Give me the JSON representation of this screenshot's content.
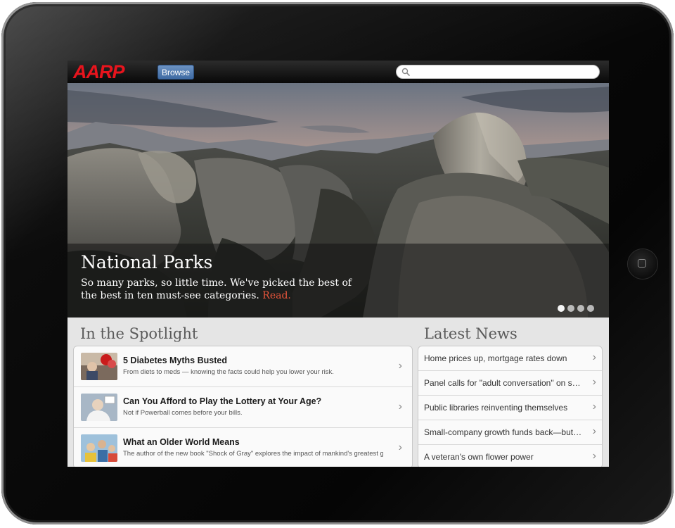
{
  "header": {
    "logo_text": "AARP",
    "browse_label": "Browse",
    "search_placeholder": ""
  },
  "hero": {
    "title": "National Parks",
    "description": "So many parks, so little time. We've picked the best of the best in ten must-see categories.",
    "link_label": "Read.",
    "slides_count": 4,
    "active_slide": 1
  },
  "spotlight": {
    "heading": "In the Spotlight",
    "items": [
      {
        "title": "5 Diabetes Myths Busted",
        "description": "From diets to meds — knowing the facts could help you lower your risk."
      },
      {
        "title": "Can You Afford to Play the Lottery at Your Age?",
        "description": "Not if Powerball comes before your bills."
      },
      {
        "title": "What an Older World Means",
        "description": "The author of the new book \"Shock of Gray\" explores the impact of mankind's greatest gift to..."
      }
    ]
  },
  "news": {
    "heading": "Latest News",
    "items": [
      {
        "title": "Home prices up, mortgage rates down"
      },
      {
        "title": "Panel calls for \"adult conversation\" on spen..."
      },
      {
        "title": "Public libraries reinventing themselves"
      },
      {
        "title": "Small-company growth funds back—but still..."
      },
      {
        "title": "A veteran's own flower power"
      }
    ]
  },
  "colors": {
    "brand_red": "#e8141d",
    "browse_blue": "#4a77b0",
    "link_orange": "#e8553b"
  },
  "icons": [
    "search-icon",
    "chevron-right-icon",
    "home-button-icon"
  ]
}
